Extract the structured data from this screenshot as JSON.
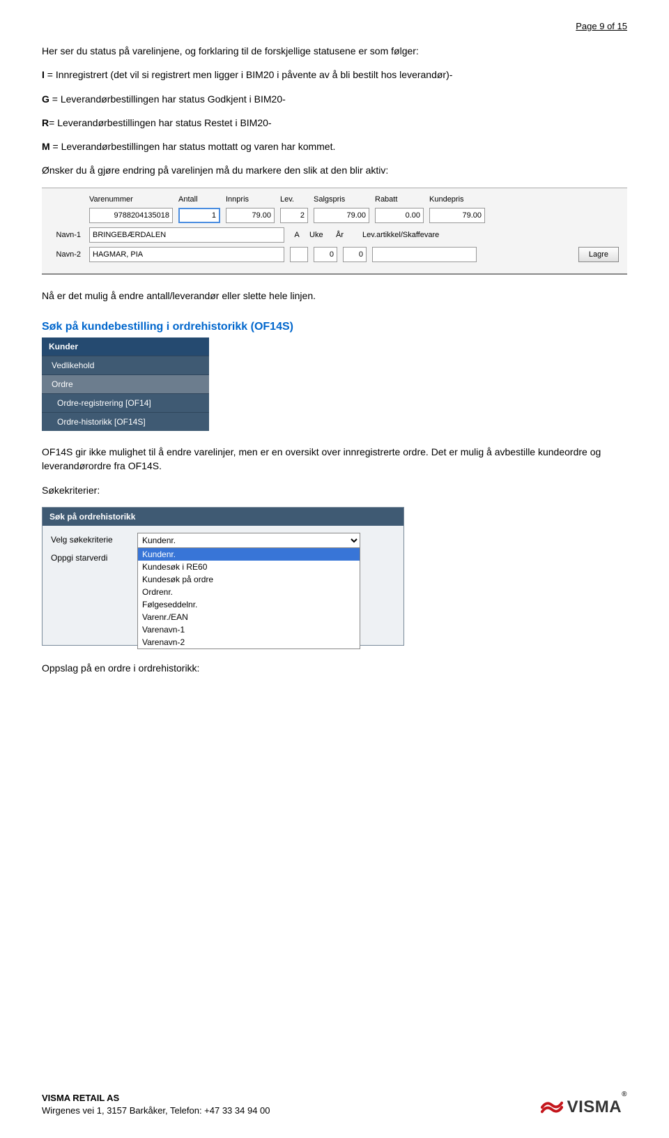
{
  "page_number": "Page 9 of 15",
  "intro": "Her ser du status på varelinjene, og forklaring til de forskjellige statusene er som følger:",
  "status_lines": [
    "I = Innregistrert (det vil si registrert men ligger i BIM20 i påvente av å bli bestilt hos leverandør)-",
    "G = Leverandørbestillingen har status Godkjent i BIM20-",
    "R= Leverandørbestillingen har status Restet i BIM20-",
    "M = Leverandørbestillingen har status mottatt og varen har kommet."
  ],
  "status_codes": [
    "I",
    "G",
    "R",
    "M"
  ],
  "after_status": "Ønsker du å gjøre endring på varelinjen må du markere den slik at den blir aktiv:",
  "sshot1": {
    "headers": [
      "Varenummer",
      "Antall",
      "Innpris",
      "Lev.",
      "Salgspris",
      "Rabatt",
      "Kundepris"
    ],
    "values": {
      "varenummer": "9788204135018",
      "antall": "1",
      "innpris": "79.00",
      "lev": "2",
      "salgspris": "79.00",
      "rabatt": "0.00",
      "kundepris": "79.00"
    },
    "row1_label": "Navn-1",
    "row1_val": "BRINGEBÆRDALEN",
    "row1_a": "A",
    "row1_uke": "Uke",
    "row1_ar": "År",
    "row1_levart": "Lev.artikkel/Skaffevare",
    "row2_label": "Navn-2",
    "row2_val": "HAGMAR, PIA",
    "row2_n1": "0",
    "row2_n2": "0",
    "lagre": "Lagre"
  },
  "after_sshot1": "Nå er det mulig å endre antall/leverandør eller slette hele linjen.",
  "heading": "Søk på kundebestilling i ordrehistorikk (OF14S)",
  "sshot2": {
    "header": "Kunder",
    "items": [
      "Vedlikehold",
      "Ordre",
      "Ordre-registrering [OF14]",
      "Ordre-historikk [OF14S]"
    ]
  },
  "after_sshot2": "OF14S gir ikke mulighet til å endre varelinjer, men er en oversikt over innregistrerte ordre. Det er mulig å avbestille kundeordre og leverandørordre fra OF14S.",
  "sokekriterier_label": "Søkekriterier:",
  "sshot3": {
    "title": "Søk på ordrehistorikk",
    "lbl1": "Velg søkekriterie",
    "lbl2": "Oppgi starverdi",
    "selected": "Kundenr.",
    "options": [
      "Kundenr.",
      "Kundesøk i RE60",
      "Kundesøk på ordre",
      "Ordrenr.",
      "Følgeseddelnr.",
      "Varenr./EAN",
      "Varenavn-1",
      "Varenavn-2"
    ]
  },
  "after_sshot3": "Oppslag på en ordre i ordrehistorikk:",
  "footer": {
    "company": "VISMA RETAIL AS",
    "address": "Wirgenes vei 1, 3157 Barkåker, Telefon: +47 33 34 94 00",
    "brand": "VISMA"
  }
}
